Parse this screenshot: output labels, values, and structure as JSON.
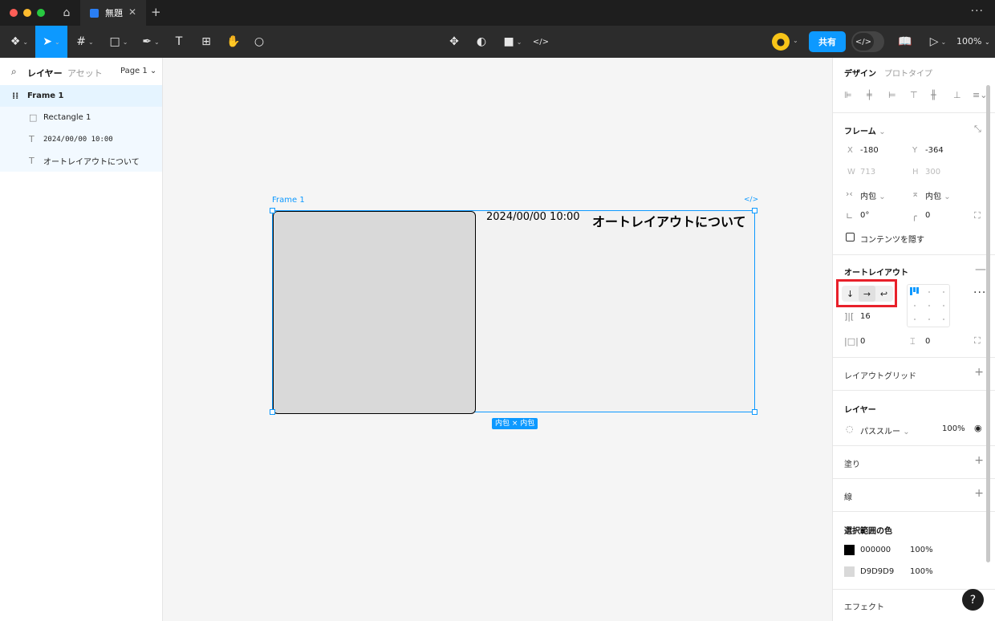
{
  "titlebar": {
    "file_tab": "無題",
    "close_glyph": "✕",
    "new_tab_glyph": "+",
    "more_glyph": "···"
  },
  "toolbar": {
    "share_label": "共有",
    "zoom": "100%",
    "devmode_glyph": "</>"
  },
  "left_panel": {
    "tab_layers": "レイヤー",
    "tab_assets": "アセット",
    "page": "Page 1",
    "layers": [
      {
        "name": "Frame 1",
        "icon": "auto-layout-frame-icon"
      },
      {
        "name": "Rectangle 1",
        "icon": "rectangle-icon"
      },
      {
        "name": "2024/00/00 10:00",
        "icon": "text-icon"
      },
      {
        "name": "オートレイアウトについて",
        "icon": "text-icon"
      }
    ]
  },
  "canvas": {
    "frame_label": "Frame 1",
    "frame_code_glyph": "</>",
    "date_text": "2024/00/00 10:00",
    "heading_text": "オートレイアウトについて",
    "size_badge": "内包 × 内包"
  },
  "right_panel": {
    "tab_design": "デザイン",
    "tab_prototype": "プロトタイプ",
    "frame_title": "フレーム",
    "x_label": "X",
    "x_value": "-180",
    "y_label": "Y",
    "y_value": "-364",
    "w_label": "W",
    "w_value": "713",
    "h_label": "H",
    "h_value": "300",
    "width_mode": "内包",
    "height_mode": "内包",
    "rotation": "0°",
    "radius": "0",
    "clip_content": "コンテンツを隠す",
    "auto_layout_title": "オートレイアウト",
    "gap": "16",
    "padding_h": "0",
    "padding_v": "0",
    "layout_grid_title": "レイアウトグリッド",
    "layer_title": "レイヤー",
    "blend_mode": "パススルー",
    "layer_opacity": "100%",
    "fill_title": "塗り",
    "stroke_title": "線",
    "selection_colors_title": "選択範囲の色",
    "colors": [
      {
        "hex": "000000",
        "opacity": "100%",
        "swatch": "#000000"
      },
      {
        "hex": "D9D9D9",
        "opacity": "100%",
        "swatch": "#D9D9D9"
      }
    ],
    "effects_title": "エフェクト"
  },
  "help_glyph": "?"
}
